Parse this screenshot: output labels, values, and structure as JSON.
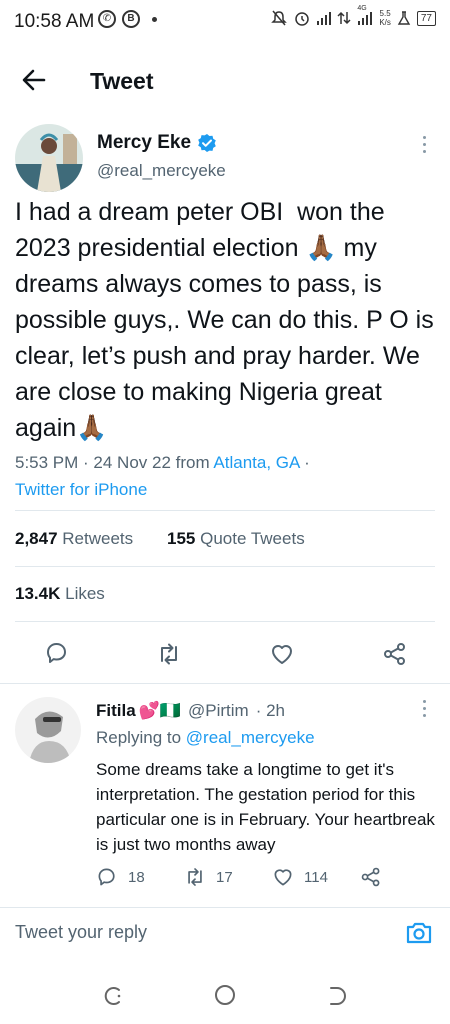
{
  "status_bar": {
    "time": "10:58 AM",
    "left_icons": [
      "whatsapp-icon",
      "b-circle-icon",
      "dot"
    ],
    "net_type": "4G",
    "speed_value": "5.5",
    "speed_unit": "K/s",
    "battery": "77"
  },
  "header": {
    "title": "Tweet"
  },
  "tweet": {
    "author_name": "Mercy Eke",
    "author_handle": "@real_mercyeke",
    "verified": true,
    "text": "I had a dream peter OBI  won the 2023 presidential election 🙏🏾 my dreams always comes to pass, is possible guys,. We can do this. P O is clear, let’s push and pray harder. We are close to making Nigeria great again🙏🏾",
    "time_date": "5:53 PM · 24 Nov 22 from ",
    "location": "Atlanta, GA",
    "separator": " ·",
    "source": "Twitter for iPhone",
    "retweets_count": "2,847",
    "retweets_label": "Retweets",
    "quotes_count": "155",
    "quotes_label": "Quote Tweets",
    "likes_count": "13.4K",
    "likes_label": "Likes"
  },
  "reply": {
    "author_name": "Fitila",
    "author_emoji": "💕🇳🇬",
    "author_handle": "@Pirtim",
    "time": "· 2h",
    "replying_prefix": "Replying to ",
    "replying_to": "@real_mercyeke",
    "text": "Some dreams take a longtime to get it's interpretation. The gestation period for this particular one is in February.  Your heartbreak is just two months away",
    "reply_count": "18",
    "retweet_count": "17",
    "like_count": "114"
  },
  "compose": {
    "placeholder": "Tweet your reply"
  },
  "colors": {
    "accent": "#1d9bf0",
    "text": "#0f1419",
    "muted": "#536471",
    "divider": "#e1e8ed"
  }
}
